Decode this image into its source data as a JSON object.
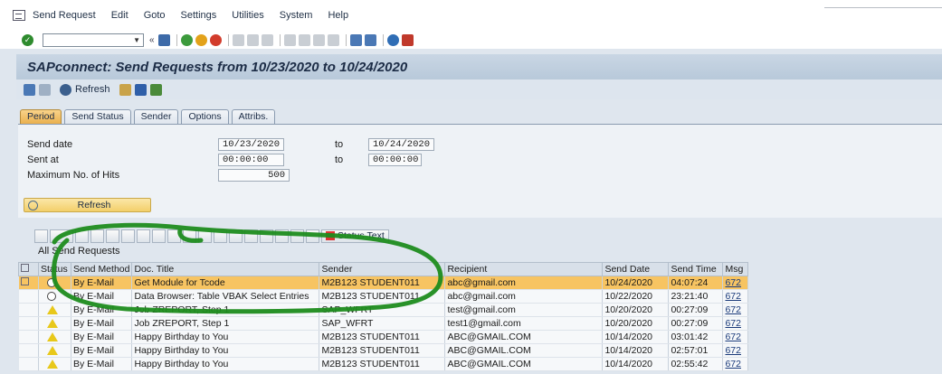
{
  "menu": [
    "Send Request",
    "Edit",
    "Goto",
    "Settings",
    "Utilities",
    "System",
    "Help"
  ],
  "title": "SAPconnect: Send Requests from 10/23/2020 to 10/24/2020",
  "app_toolbar": {
    "refresh_label": "Refresh"
  },
  "tabs": [
    "Period",
    "Send Status",
    "Sender",
    "Options",
    "Attribs."
  ],
  "form": {
    "send_date_label": "Send date",
    "send_date_from": "10/23/2020",
    "to_label_1": "to",
    "send_date_to": "10/24/2020",
    "sent_at_label": "Sent at",
    "sent_at_from": "00:00:00",
    "to_label_2": "to",
    "sent_at_to": "00:00:00",
    "max_hits_label": "Maximum No. of Hits",
    "max_hits": "500",
    "refresh_button": "Refresh"
  },
  "alv": {
    "status_text_button": "Status Text",
    "list_title": "All Send Requests",
    "columns": [
      "Status",
      "Send Method",
      "Doc. Title",
      "Sender",
      "Recipient",
      "Send Date",
      "Send Time",
      "Msg"
    ],
    "rows": [
      {
        "status": "clock",
        "method": "By E-Mail",
        "title": "Get Module for Tcode",
        "sender": "M2B123 STUDENT011",
        "recipient": "abc@gmail.com",
        "date": "10/24/2020",
        "time": "04:07:24",
        "msg": "672"
      },
      {
        "status": "clock",
        "method": "By E-Mail",
        "title": "Data Browser: Table VBAK Select Entries",
        "sender": "M2B123 STUDENT011",
        "recipient": "abc@gmail.com",
        "date": "10/22/2020",
        "time": "23:21:40",
        "msg": "672"
      },
      {
        "status": "warning",
        "method": "By E-Mail",
        "title": "Job ZREPORT, Step 1",
        "sender": "SAP_WFRT",
        "recipient": "test@gmail.com",
        "date": "10/20/2020",
        "time": "00:27:09",
        "msg": "672"
      },
      {
        "status": "warning",
        "method": "By E-Mail",
        "title": "Job ZREPORT, Step 1",
        "sender": "SAP_WFRT",
        "recipient": "test1@gmail.com",
        "date": "10/20/2020",
        "time": "00:27:09",
        "msg": "672"
      },
      {
        "status": "warning",
        "method": "By E-Mail",
        "title": "Happy Birthday to You",
        "sender": "M2B123 STUDENT011",
        "recipient": "ABC@GMAIL.COM",
        "date": "10/14/2020",
        "time": "03:01:42",
        "msg": "672"
      },
      {
        "status": "warning",
        "method": "By E-Mail",
        "title": "Happy Birthday to You",
        "sender": "M2B123 STUDENT011",
        "recipient": "ABC@GMAIL.COM",
        "date": "10/14/2020",
        "time": "02:57:01",
        "msg": "672"
      },
      {
        "status": "warning",
        "method": "By E-Mail",
        "title": "Happy Birthday to You",
        "sender": "M2B123 STUDENT011",
        "recipient": "ABC@GMAIL.COM",
        "date": "10/14/2020",
        "time": "02:55:42",
        "msg": "672"
      }
    ]
  },
  "colors": {
    "selected_row": "#f7c462",
    "annotation": "#1e8c1e",
    "title_bar": "#c9d6e4"
  }
}
